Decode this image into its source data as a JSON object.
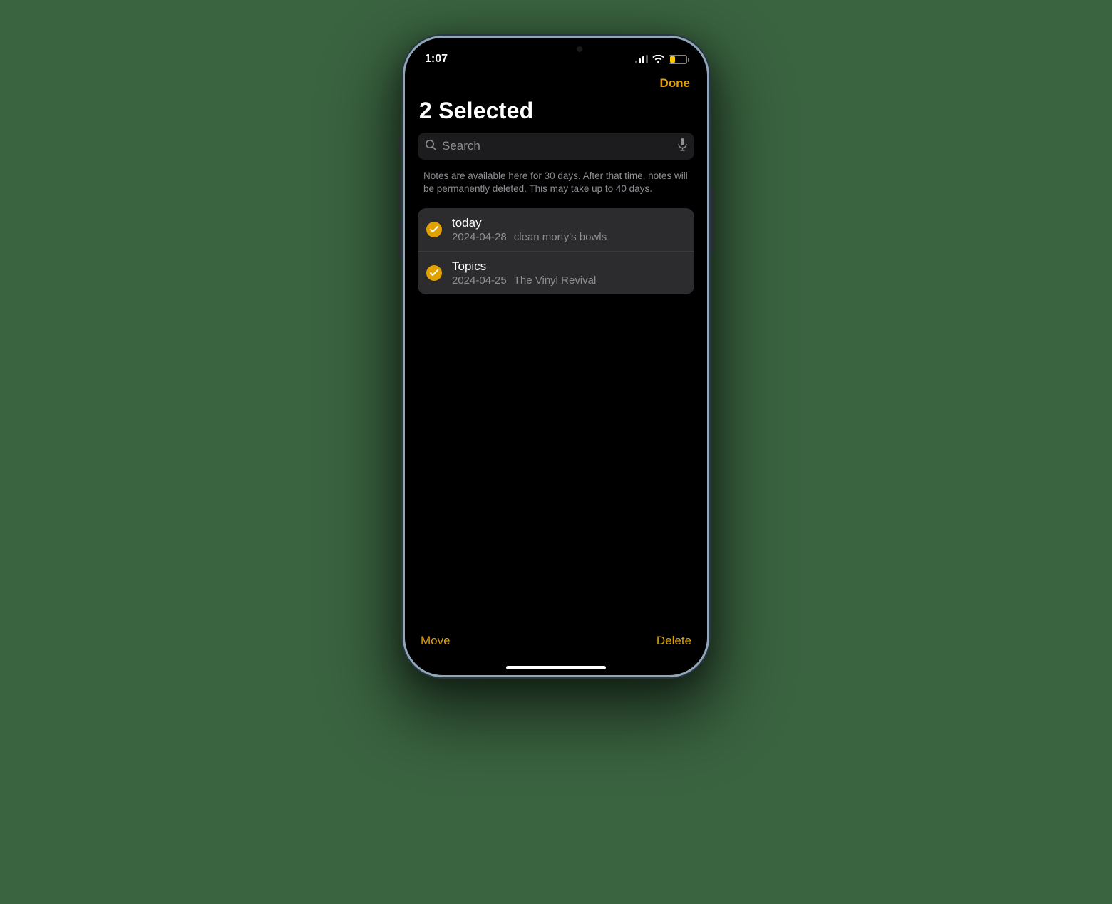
{
  "status": {
    "time": "1:07"
  },
  "nav": {
    "done": "Done"
  },
  "header": {
    "title": "2 Selected"
  },
  "search": {
    "placeholder": "Search"
  },
  "info": "Notes are available here for 30 days. After that time, notes will be permanently deleted. This may take up to 40 days.",
  "notes": [
    {
      "title": "today",
      "date": "2024-04-28",
      "preview": "clean morty's bowls"
    },
    {
      "title": "Topics",
      "date": "2024-04-25",
      "preview": "The Vinyl Revival"
    }
  ],
  "toolbar": {
    "move": "Move",
    "delete": "Delete"
  },
  "colors": {
    "accent": "#e1a100"
  }
}
